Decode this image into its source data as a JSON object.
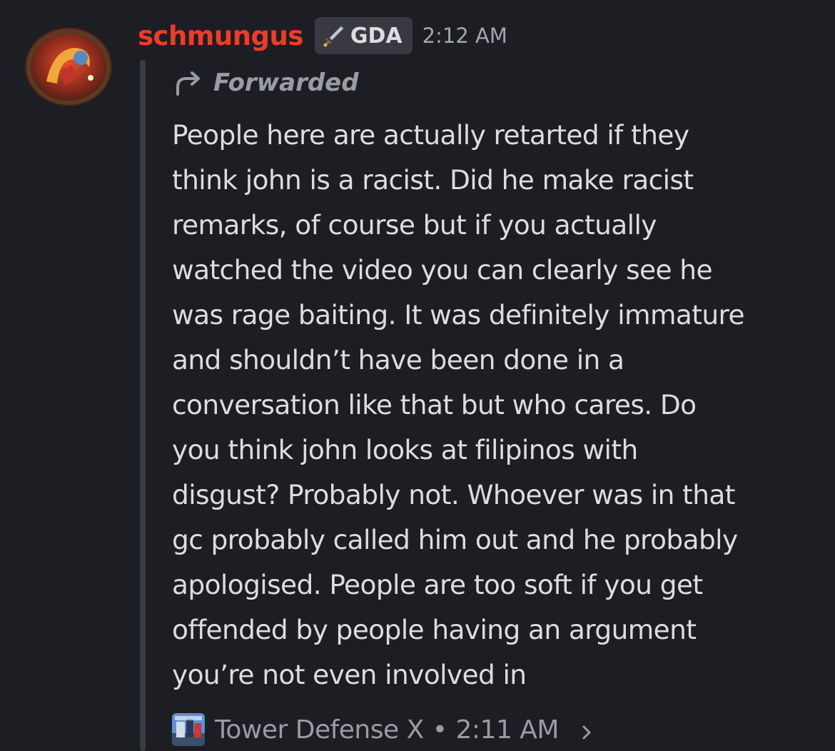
{
  "message": {
    "username": "schmungus",
    "tag": "GDA",
    "timestamp": "2:12 AM",
    "forwarded_label": "Forwarded",
    "text": "People here are actually retarted if they\nthink john is a racist. Did he make racist\nremarks, of course but if you actually\nwatched the video you can clearly see he\nwas rage baiting. It was definitely immature\nand shouldn’t have been done in a\nconversation like that but who cares. Do\nyou think john looks at filipinos with\ndisgust? Probably not. Whoever was in that\ngc probably called him out and he probably\napologised. People are too soft if you get\noffended by people having an argument\nyou’re not even involved in",
    "source": {
      "server": "Tower Defense X",
      "separator": "•",
      "time": "2:11 AM"
    }
  },
  "colors": {
    "background": "#1d1e23",
    "username": "#ec3d2a",
    "text": "#dcdde2",
    "muted": "#9a9ca4",
    "tag_bg": "#393a41"
  },
  "icons": {
    "avatar": "avatar-image",
    "tag": "sword-icon",
    "forward": "forward-arrow-icon",
    "server": "server-icon",
    "chevron": "chevron-right-icon"
  }
}
